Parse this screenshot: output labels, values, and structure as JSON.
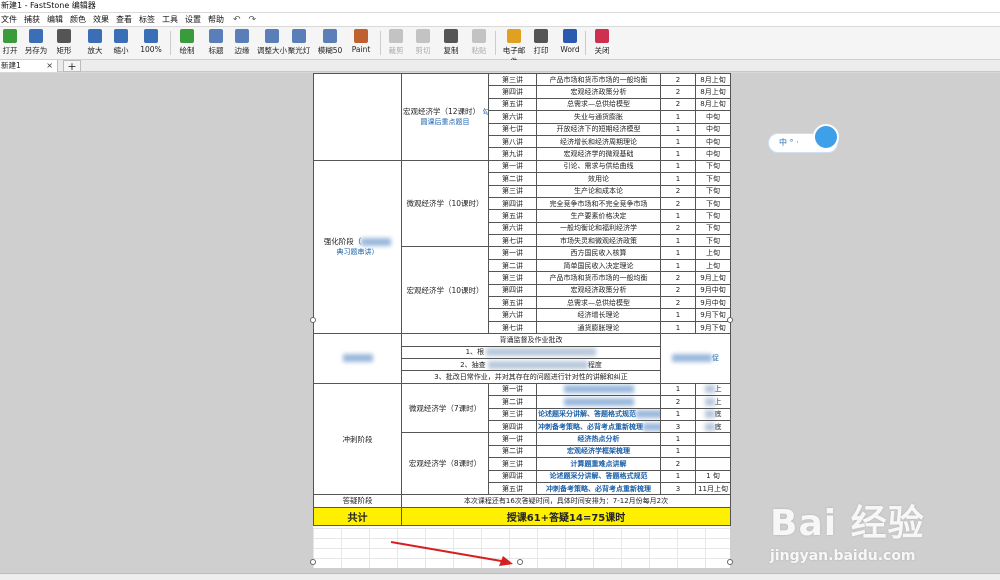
{
  "window": {
    "title": "新建1 - FastStone 编辑器"
  },
  "menu": [
    "文件",
    "捕获",
    "编辑",
    "颜色",
    "效果",
    "查看",
    "标签",
    "工具",
    "设置",
    "帮助"
  ],
  "toolbar": [
    {
      "label": "打开",
      "icon": "open-icon",
      "color": "#3a9b3a",
      "disabled": false
    },
    {
      "label": "另存为",
      "icon": "save-icon",
      "color": "#3a6fb8",
      "disabled": false
    },
    {
      "label": "矩形",
      "icon": "rect-select-icon",
      "color": "#555555",
      "disabled": false
    },
    {
      "label": "放大",
      "icon": "zoom-in-icon",
      "color": "#3a6fb8",
      "disabled": false
    },
    {
      "label": "缩小",
      "icon": "zoom-out-icon",
      "color": "#3a6fb8",
      "disabled": false
    },
    {
      "label": "100%",
      "icon": "zoom-100-icon",
      "color": "#3a6fb8",
      "disabled": false
    },
    {
      "label": "绘制",
      "icon": "draw-icon",
      "color": "#3a9b3a",
      "disabled": false
    },
    {
      "label": "标题",
      "icon": "caption-icon",
      "color": "#5a7fb8",
      "disabled": false
    },
    {
      "label": "边缘",
      "icon": "edge-icon",
      "color": "#5a7fb8",
      "disabled": false
    },
    {
      "label": "调整大小",
      "icon": "resize-icon",
      "color": "#5a7fb8",
      "disabled": false
    },
    {
      "label": "聚光灯",
      "icon": "spotlight-icon",
      "color": "#5a7fb8",
      "disabled": false
    },
    {
      "label": "模糊50",
      "icon": "blur-icon",
      "color": "#5a7fb8",
      "disabled": false
    },
    {
      "label": "Paint",
      "icon": "paint-icon",
      "color": "#c06030",
      "disabled": false
    },
    {
      "label": "裁剪",
      "icon": "crop-icon",
      "color": "#888888",
      "disabled": true
    },
    {
      "label": "剪切",
      "icon": "cut-icon",
      "color": "#888888",
      "disabled": true
    },
    {
      "label": "复制",
      "icon": "copy-icon",
      "color": "#555555",
      "disabled": false
    },
    {
      "label": "粘贴",
      "icon": "paste-icon",
      "color": "#888888",
      "disabled": true
    },
    {
      "label": "电子邮件",
      "icon": "email-icon",
      "color": "#e0a020",
      "disabled": false
    },
    {
      "label": "打印",
      "icon": "print-icon",
      "color": "#555555",
      "disabled": false
    },
    {
      "label": "Word",
      "icon": "word-icon",
      "color": "#2a5ab0",
      "disabled": false
    },
    {
      "label": "关闭",
      "icon": "close-icon",
      "color": "#d03050",
      "disabled": false
    }
  ],
  "tabs": [
    {
      "label": "新建1"
    }
  ],
  "floattool": {
    "text": "中 ° ·"
  },
  "table": {
    "macro1": {
      "course": "宏观经济学（12课时）",
      "note": "圆课后重点题目",
      "side": "勾"
    },
    "rows_a": [
      {
        "lec": "第三讲",
        "topic": "产品市场和货币市场的一般均衡",
        "hours": "2",
        "time": "8月上旬"
      },
      {
        "lec": "第四讲",
        "topic": "宏观经济政策分析",
        "hours": "2",
        "time": "8月上旬"
      },
      {
        "lec": "第五讲",
        "topic": "总需求—总供给模型",
        "hours": "2",
        "time": "8月上旬"
      },
      {
        "lec": "第六讲",
        "topic": "失业与通货膨胀",
        "hours": "1",
        "time": "中旬"
      },
      {
        "lec": "第七讲",
        "topic": "开放经济下的短期经济模型",
        "hours": "1",
        "time": "中旬"
      },
      {
        "lec": "第八讲",
        "topic": "经济增长和经济周期理论",
        "hours": "1",
        "time": "中旬"
      },
      {
        "lec": "第九讲",
        "topic": "宏观经济学的微观基础",
        "hours": "1",
        "time": "中旬"
      }
    ],
    "stage2": {
      "label": "强化阶段（",
      "sub": "典习题串讲）"
    },
    "micro10": {
      "course": "微观经济学（10课时）"
    },
    "rows_b": [
      {
        "lec": "第一讲",
        "topic": "引论、需求与供给曲线",
        "hours": "1",
        "time": "下旬"
      },
      {
        "lec": "第二讲",
        "topic": "效用论",
        "hours": "1",
        "time": "下旬"
      },
      {
        "lec": "第三讲",
        "topic": "生产论和成本论",
        "hours": "2",
        "time": "下旬"
      },
      {
        "lec": "第四讲",
        "topic": "完全竞争市场和不完全竞争市场",
        "hours": "2",
        "time": "下旬"
      },
      {
        "lec": "第五讲",
        "topic": "生产要素价格决定",
        "hours": "1",
        "time": "下旬"
      },
      {
        "lec": "第六讲",
        "topic": "一般均衡论和福利经济学",
        "hours": "2",
        "time": "下旬"
      },
      {
        "lec": "第七讲",
        "topic": "市场失灵和微观经济政策",
        "hours": "1",
        "time": "下旬"
      }
    ],
    "macro10": {
      "course": "宏观经济学（10课时）"
    },
    "rows_c": [
      {
        "lec": "第一讲",
        "topic": "西方国民收入核算",
        "hours": "1",
        "time": "上旬"
      },
      {
        "lec": "第二讲",
        "topic": "简单国民收入决定理论",
        "hours": "1",
        "time": "上旬"
      },
      {
        "lec": "第三讲",
        "topic": "产品市场和货币市场的一般均衡",
        "hours": "2",
        "time": "9月上旬"
      },
      {
        "lec": "第四讲",
        "topic": "宏观经济政策分析",
        "hours": "2",
        "time": "9月中旬"
      },
      {
        "lec": "第五讲",
        "topic": "总需求—总供给模型",
        "hours": "2",
        "time": "9月中旬"
      },
      {
        "lec": "第六讲",
        "topic": "经济增长理论",
        "hours": "1",
        "time": "9月下旬"
      },
      {
        "lec": "第七讲",
        "topic": "通货膨胀理论",
        "hours": "1",
        "time": "9月下旬"
      }
    ],
    "supervise": [
      "背诵监督及作业批改",
      "1、根",
      "2、抽查",
      "3、批改日常作业，并对其存在的问题进行针对性的讲解和纠正"
    ],
    "supervise_right": "促",
    "supervise_mid": "程度",
    "sprint": {
      "label": "冲刺阶段"
    },
    "micro7": {
      "course": "微观经济学（7课时）"
    },
    "rows_d": [
      {
        "lec": "第一讲",
        "topic": "",
        "hours": "1",
        "time": "上",
        "blue": true
      },
      {
        "lec": "第二讲",
        "topic": "",
        "hours": "2",
        "time": "上",
        "blue": true
      },
      {
        "lec": "第三讲",
        "topic": "论述题采分讲解、答题格式规范",
        "hours": "1",
        "time": "底",
        "blue": true
      },
      {
        "lec": "第四讲",
        "topic": "冲刺备考策略、必背考点重新梳理",
        "hours": "3",
        "time": "底",
        "blue": true
      }
    ],
    "macro8": {
      "course": "宏观经济学（8课时）"
    },
    "rows_e": [
      {
        "lec": "第一讲",
        "topic": "经济热点分析",
        "hours": "1",
        "time": "",
        "blue": true
      },
      {
        "lec": "第二讲",
        "topic": "宏观经济学框架梳理",
        "hours": "1",
        "time": "",
        "blue": true
      },
      {
        "lec": "第三讲",
        "topic": "计算题重难点讲解",
        "hours": "2",
        "time": "",
        "blue": true
      },
      {
        "lec": "第四讲",
        "topic": "论述题采分讲解、答题格式规范",
        "hours": "1",
        "time": "1 旬",
        "blue": true
      },
      {
        "lec": "第五讲",
        "topic": "冲刺备考策略、必背考点重新梳理",
        "hours": "3",
        "time": "11月上旬",
        "blue": true
      }
    ],
    "qa": {
      "label": "答疑阶段",
      "text": "本次课程还有16次答疑时间，具体时间安排为：7-12月份每月2次"
    },
    "total": {
      "label": "共计",
      "text": "授课61+答疑14=75课时"
    }
  },
  "watermark": {
    "big": "Bai 经验",
    "small": "jingyan.baidu.com"
  },
  "colors": {
    "total_bg": "#ffef00",
    "blue_text": "#1a5fa8",
    "arrow": "#d42020"
  }
}
